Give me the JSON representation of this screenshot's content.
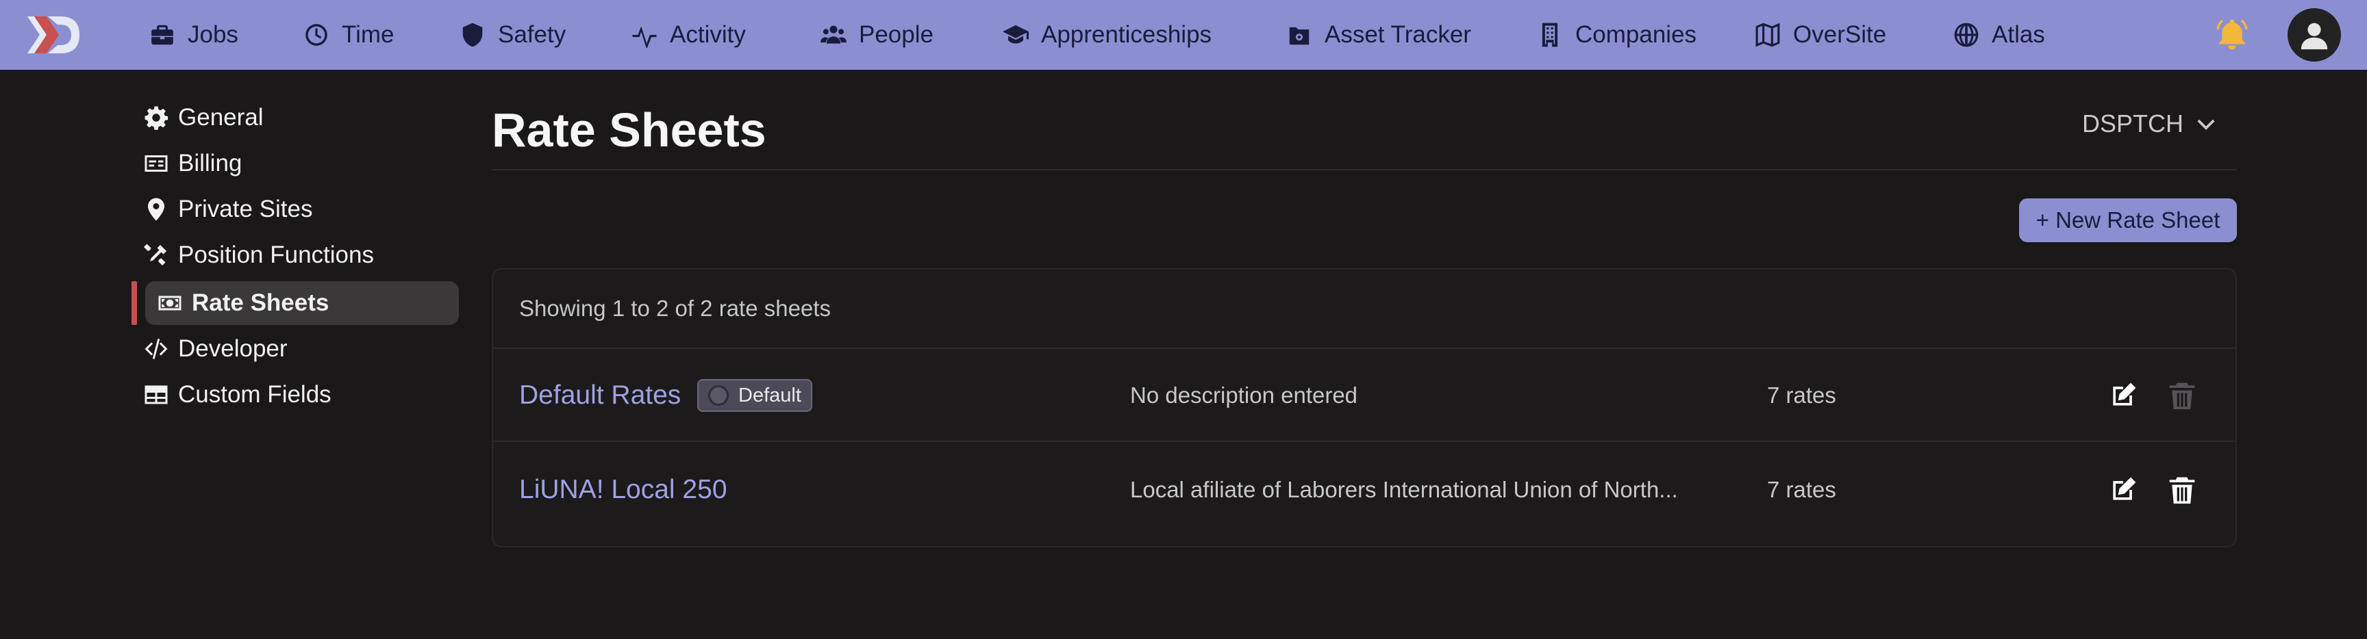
{
  "nav": {
    "items": [
      {
        "label": "Jobs",
        "icon": "briefcase-icon"
      },
      {
        "label": "Time",
        "icon": "clock-icon"
      },
      {
        "label": "Safety",
        "icon": "shield-icon"
      },
      {
        "label": "Activity",
        "icon": "pulse-icon"
      },
      {
        "label": "People",
        "icon": "users-icon"
      },
      {
        "label": "Apprenticeships",
        "icon": "graduation-cap-icon"
      },
      {
        "label": "Asset Tracker",
        "icon": "asset-box-icon"
      },
      {
        "label": "Companies",
        "icon": "building-icon"
      },
      {
        "label": "OverSite",
        "icon": "map-icon"
      },
      {
        "label": "Atlas",
        "icon": "globe-icon"
      }
    ]
  },
  "sidebar": {
    "items": [
      {
        "label": "General",
        "icon": "gear-icon"
      },
      {
        "label": "Billing",
        "icon": "billing-card-icon"
      },
      {
        "label": "Private Sites",
        "icon": "location-pin-icon"
      },
      {
        "label": "Position Functions",
        "icon": "tools-icon"
      },
      {
        "label": "Rate Sheets",
        "icon": "money-bill-icon",
        "active": true
      },
      {
        "label": "Developer",
        "icon": "code-icon"
      },
      {
        "label": "Custom Fields",
        "icon": "table-icon"
      }
    ]
  },
  "main": {
    "title": "Rate Sheets",
    "org_selector": "DSPTCH",
    "new_button": "+ New Rate Sheet",
    "summary": "Showing 1 to 2 of 2 rate sheets",
    "rows": [
      {
        "name": "Default Rates",
        "badge": "Default",
        "description": "No description entered",
        "count": "7 rates",
        "delete_enabled": false
      },
      {
        "name": "LiUNA! Local 250",
        "description": "Local afiliate of Laborers International Union of North...",
        "count": "7 rates",
        "delete_enabled": true
      }
    ]
  },
  "colors": {
    "nav_bg": "#8b8fd1",
    "page_bg": "#1a1819",
    "accent_link": "#9ea2e2",
    "active_indicator": "#c8504f",
    "bell": "#f5b63c"
  }
}
